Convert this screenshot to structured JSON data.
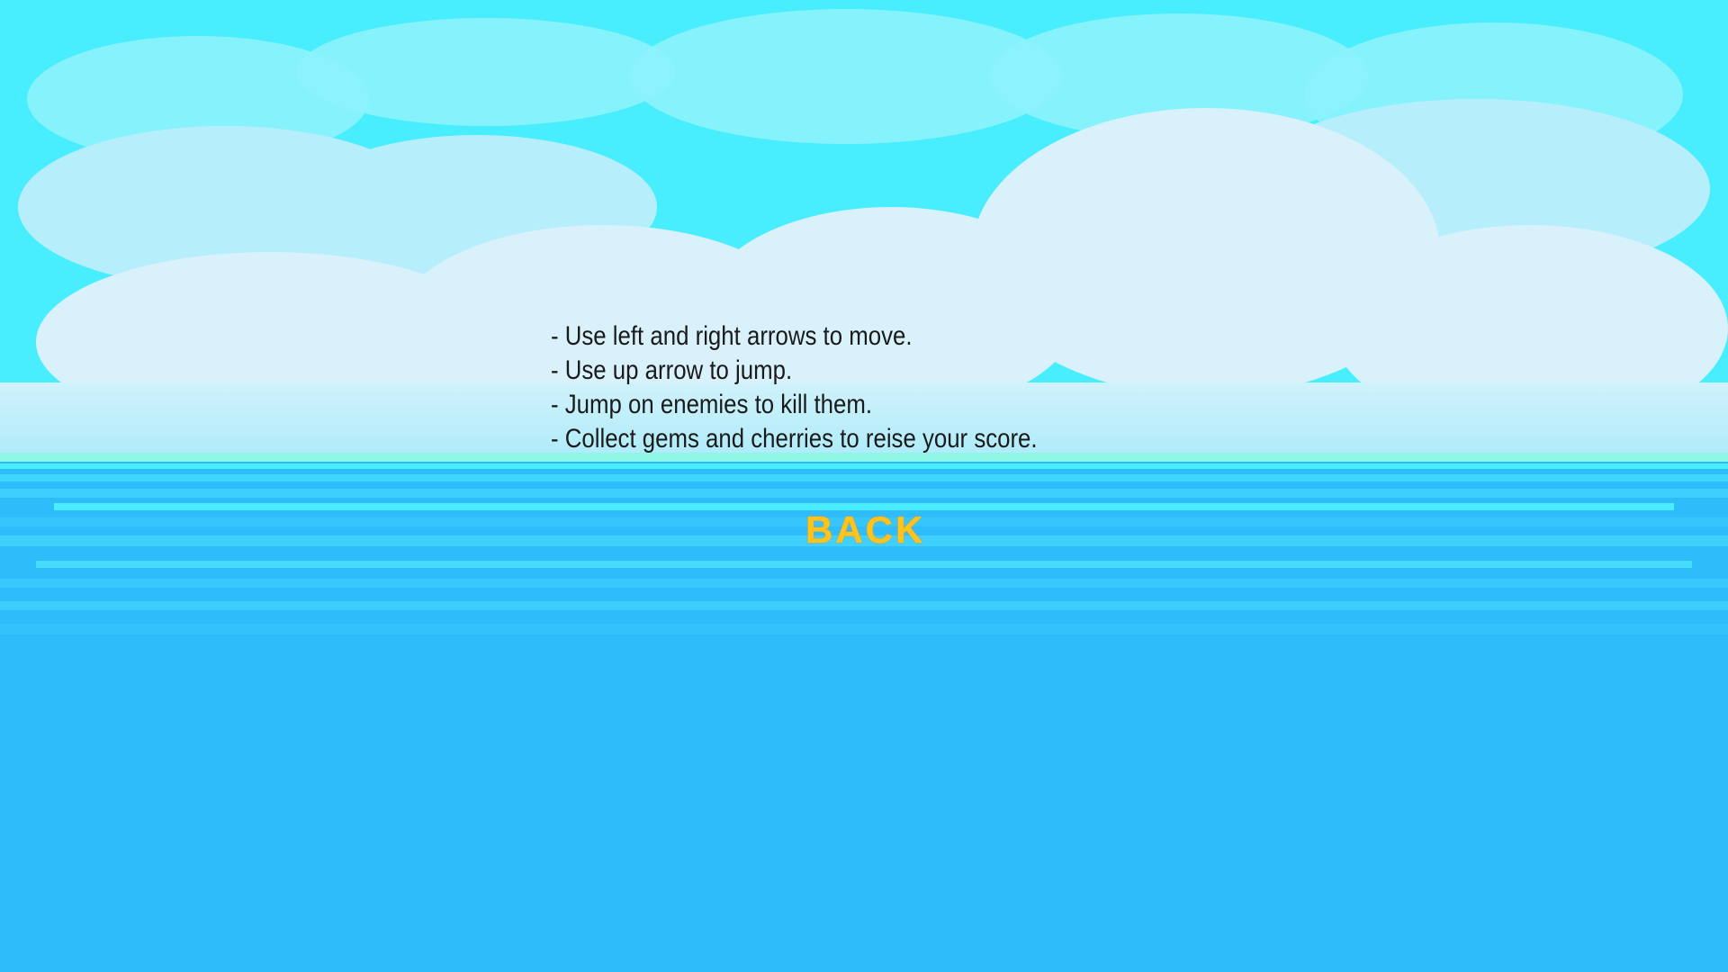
{
  "screen": "instructions",
  "instructions": {
    "lines": [
      "- Use left and right arrows to move.",
      "- Use up arrow to jump.",
      "- Jump on enemies to kill them.",
      "- Collect gems and cherries to reise your score."
    ]
  },
  "back_button": {
    "label": "BACK",
    "color": "#ffc31e"
  },
  "colors": {
    "sky": "#48eefd",
    "clouds_light": "#d8f1fb",
    "clouds_mid": "#b6eefb",
    "sea": "#2fbcfb",
    "sea_light": "#3fd0fd",
    "foam": "#8ff6e6"
  }
}
